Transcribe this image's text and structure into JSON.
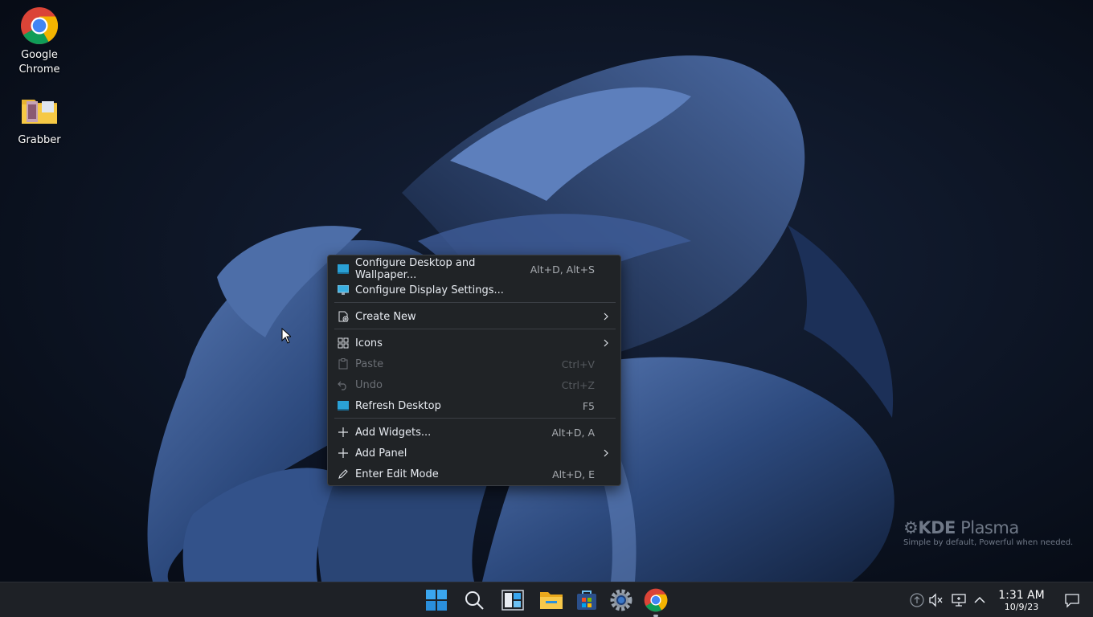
{
  "desktop": {
    "icons": [
      {
        "label_line1": "Google",
        "label_line2": "Chrome"
      },
      {
        "label_line1": "Grabber",
        "label_line2": ""
      }
    ],
    "watermark": {
      "brand_bold": "KDE",
      "brand_light": " Plasma",
      "tagline": "Simple by default, Powerful when  needed."
    }
  },
  "context_menu": {
    "items": [
      {
        "label": "Configure Desktop and Wallpaper...",
        "shortcut": "Alt+D, Alt+S",
        "icon": "desktop-config-icon"
      },
      {
        "label": "Configure Display Settings...",
        "shortcut": "",
        "icon": "display-icon"
      },
      {
        "label": "Create New",
        "shortcut": "",
        "icon": "new-document-icon",
        "submenu": true
      },
      {
        "label": "Icons",
        "shortcut": "",
        "icon": "grid-icon",
        "submenu": true
      },
      {
        "label": "Paste",
        "shortcut": "Ctrl+V",
        "icon": "clipboard-icon",
        "disabled": true
      },
      {
        "label": "Undo",
        "shortcut": "Ctrl+Z",
        "icon": "undo-icon",
        "disabled": true
      },
      {
        "label": "Refresh Desktop",
        "shortcut": "F5",
        "icon": "refresh-desktop-icon"
      },
      {
        "label": "Add Widgets...",
        "shortcut": "Alt+D, A",
        "icon": "plus-icon"
      },
      {
        "label": "Add Panel",
        "shortcut": "",
        "icon": "plus-icon",
        "submenu": true
      },
      {
        "label": "Enter Edit Mode",
        "shortcut": "Alt+D, E",
        "icon": "pencil-icon"
      }
    ]
  },
  "taskbar": {
    "apps": [
      "start-menu-icon",
      "search-icon",
      "widgets-icon",
      "file-explorer-icon",
      "store-icon",
      "settings-icon",
      "chrome-icon"
    ],
    "tray": [
      "updates-icon",
      "volume-muted-icon",
      "network-icon",
      "chevron-up-icon"
    ],
    "clock": {
      "time": "1:31 AM",
      "date": "10/9/23"
    },
    "notifications_icon": "notification-icon"
  },
  "colors": {
    "accent": "#3daee9",
    "menu_bg": "#202326",
    "taskbar_bg": "#1e2126"
  }
}
